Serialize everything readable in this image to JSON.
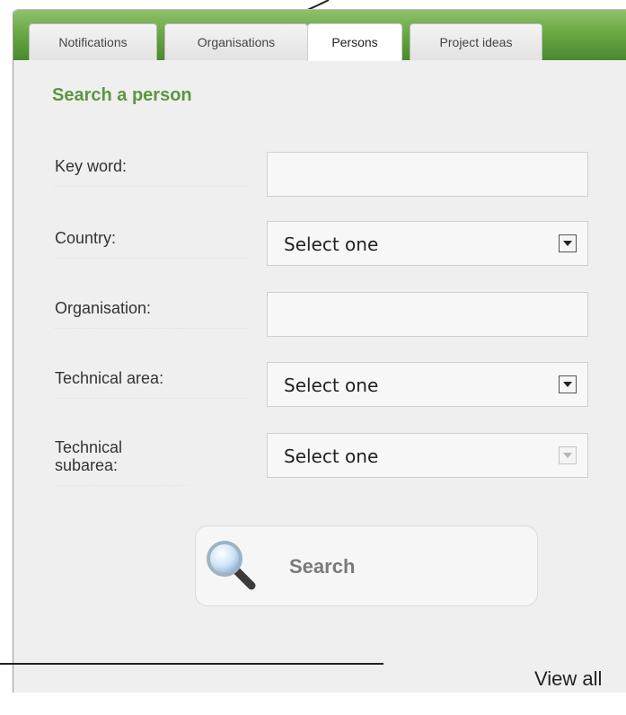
{
  "tabs": [
    {
      "label": "Notifications",
      "active": false
    },
    {
      "label": "Organisations",
      "active": false
    },
    {
      "label": "Persons",
      "active": true
    },
    {
      "label": "Project ideas",
      "active": false
    }
  ],
  "form": {
    "heading": "Search a person",
    "keyword": {
      "label": "Key word:",
      "value": ""
    },
    "country": {
      "label": "Country:",
      "selected": "Select one"
    },
    "organisation": {
      "label": "Organisation:",
      "value": ""
    },
    "technical_area": {
      "label": "Technical area:",
      "selected": "Select one"
    },
    "technical_subarea": {
      "label": "Technical subarea:",
      "selected": "Select one",
      "disabled": true
    }
  },
  "search_button": {
    "label": "Search",
    "icon": "magnifier-icon"
  },
  "view_all": "View all",
  "colors": {
    "accent": "#5c9640",
    "tabbar": "#6aa845",
    "panel": "#efefef"
  }
}
